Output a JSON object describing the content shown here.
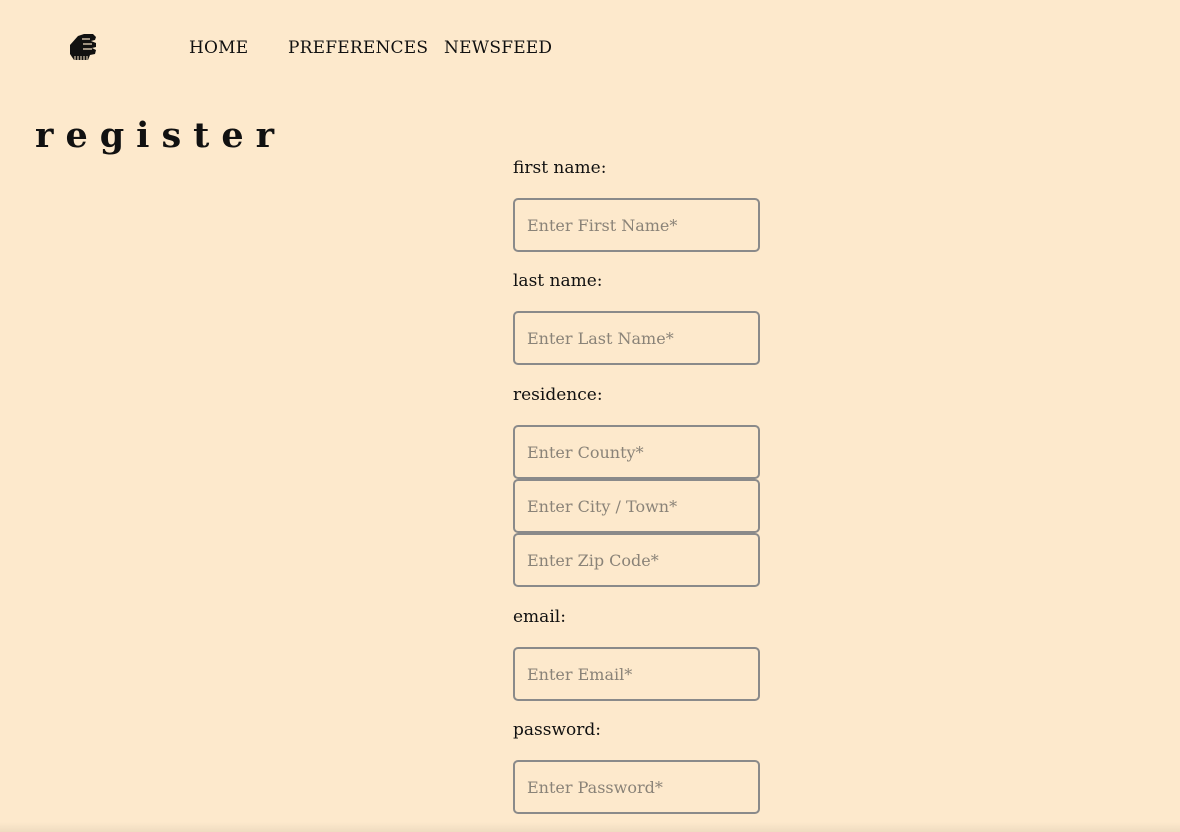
{
  "nav": {
    "logo_icon": "fist-icon",
    "items": [
      {
        "label": "HOME"
      },
      {
        "label": "PREFERENCES"
      },
      {
        "label": "NEWSFEED"
      }
    ]
  },
  "page": {
    "title": "register"
  },
  "form": {
    "first_name": {
      "label": "first name:",
      "placeholder": "Enter First Name*",
      "value": ""
    },
    "last_name": {
      "label": "last name:",
      "placeholder": "Enter Last Name*",
      "value": ""
    },
    "residence": {
      "label": "residence:",
      "county_placeholder": "Enter County*",
      "city_placeholder": "Enter City / Town*",
      "zip_placeholder": "Enter Zip Code*"
    },
    "email": {
      "label": "email:",
      "placeholder": "Enter Email*",
      "value": ""
    },
    "password": {
      "label": "password:",
      "placeholder": "Enter Password*",
      "value": ""
    }
  },
  "colors": {
    "background": "#fde9cc",
    "input_border": "#8a8a8a",
    "text": "#111111"
  }
}
